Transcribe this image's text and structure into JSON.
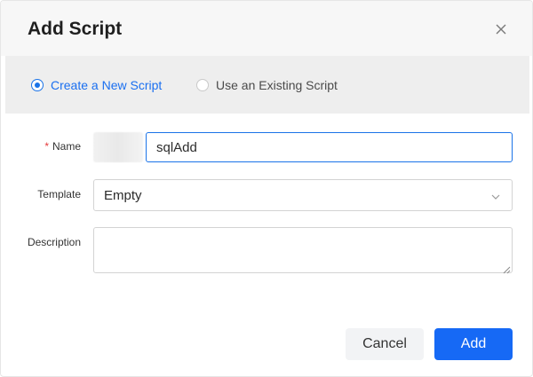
{
  "dialog": {
    "title": "Add Script",
    "close_icon": "close-icon"
  },
  "mode": {
    "options": [
      {
        "label": "Create a New Script",
        "selected": true
      },
      {
        "label": "Use an Existing Script",
        "selected": false
      }
    ]
  },
  "form": {
    "name": {
      "required_mark": "*",
      "label": "Name",
      "value": "sqlAdd"
    },
    "template": {
      "label": "Template",
      "selected": "Empty",
      "icon": "chevron-down-icon"
    },
    "description": {
      "label": "Description",
      "value": ""
    }
  },
  "footer": {
    "cancel_label": "Cancel",
    "add_label": "Add"
  },
  "colors": {
    "accent": "#1669f5",
    "required": "#e5393a",
    "header_bg": "#f7f7f7",
    "mode_bar_bg": "#eeeeee"
  }
}
